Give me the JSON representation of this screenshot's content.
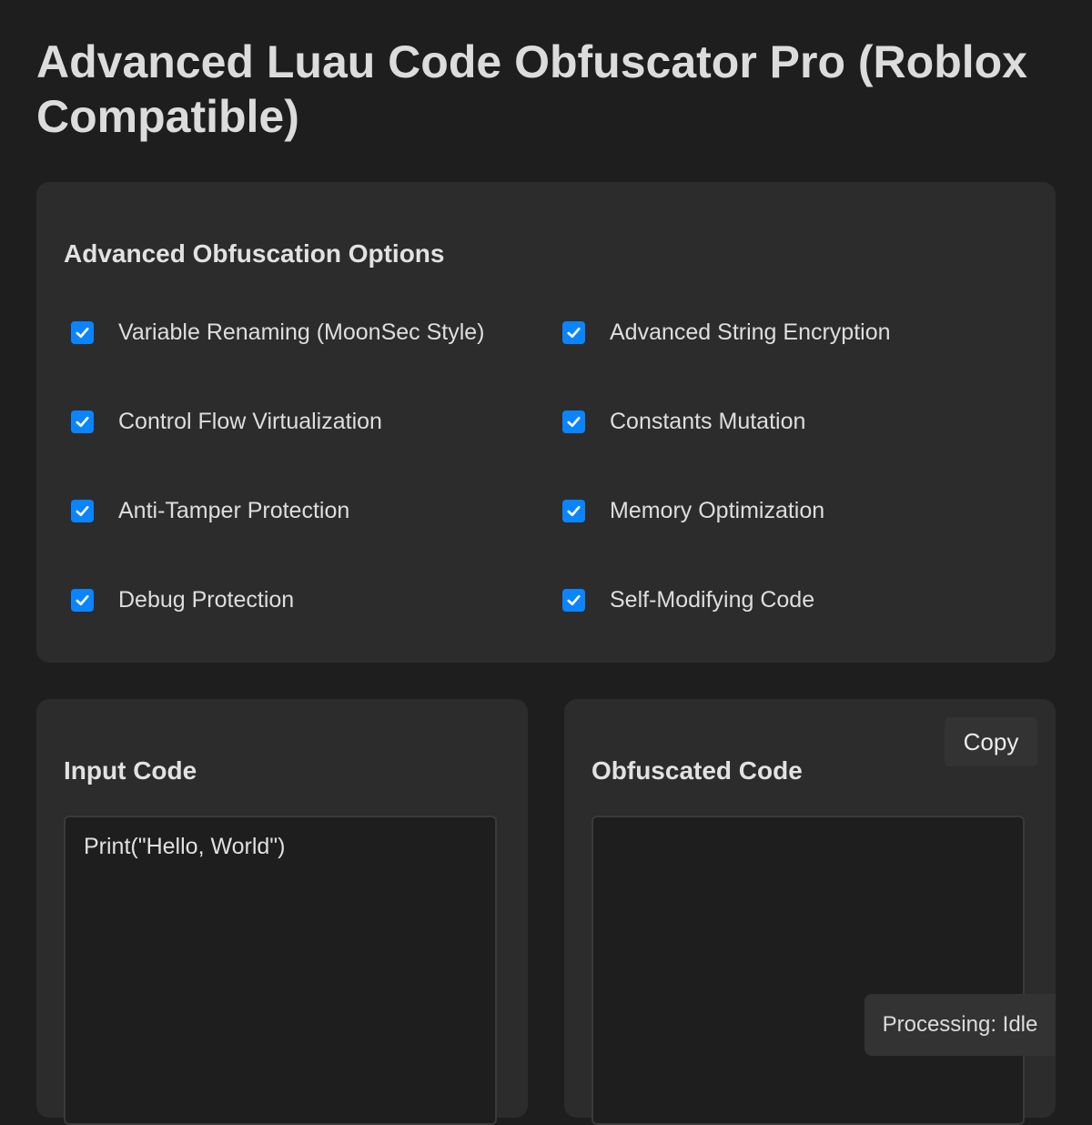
{
  "page": {
    "title": "Advanced Luau Code Obfuscator Pro (Roblox Compatible)"
  },
  "options": {
    "heading": "Advanced Obfuscation Options",
    "items": [
      {
        "label": "Variable Renaming (MoonSec Style)",
        "checked": true
      },
      {
        "label": "Advanced String Encryption",
        "checked": true
      },
      {
        "label": "Control Flow Virtualization",
        "checked": true
      },
      {
        "label": "Constants Mutation",
        "checked": true
      },
      {
        "label": "Anti-Tamper Protection",
        "checked": true
      },
      {
        "label": "Memory Optimization",
        "checked": true
      },
      {
        "label": "Debug Protection",
        "checked": true
      },
      {
        "label": "Self-Modifying Code",
        "checked": true
      }
    ]
  },
  "input_panel": {
    "heading": "Input Code",
    "value": "Print(\"Hello, World\")"
  },
  "output_panel": {
    "heading": "Obfuscated Code",
    "value": "",
    "copy_label": "Copy"
  },
  "status": {
    "text": "Processing: Idle"
  },
  "colors": {
    "background": "#1e1e1e",
    "panel": "#2c2c2c",
    "checkbox_accent": "#0a84ff"
  }
}
